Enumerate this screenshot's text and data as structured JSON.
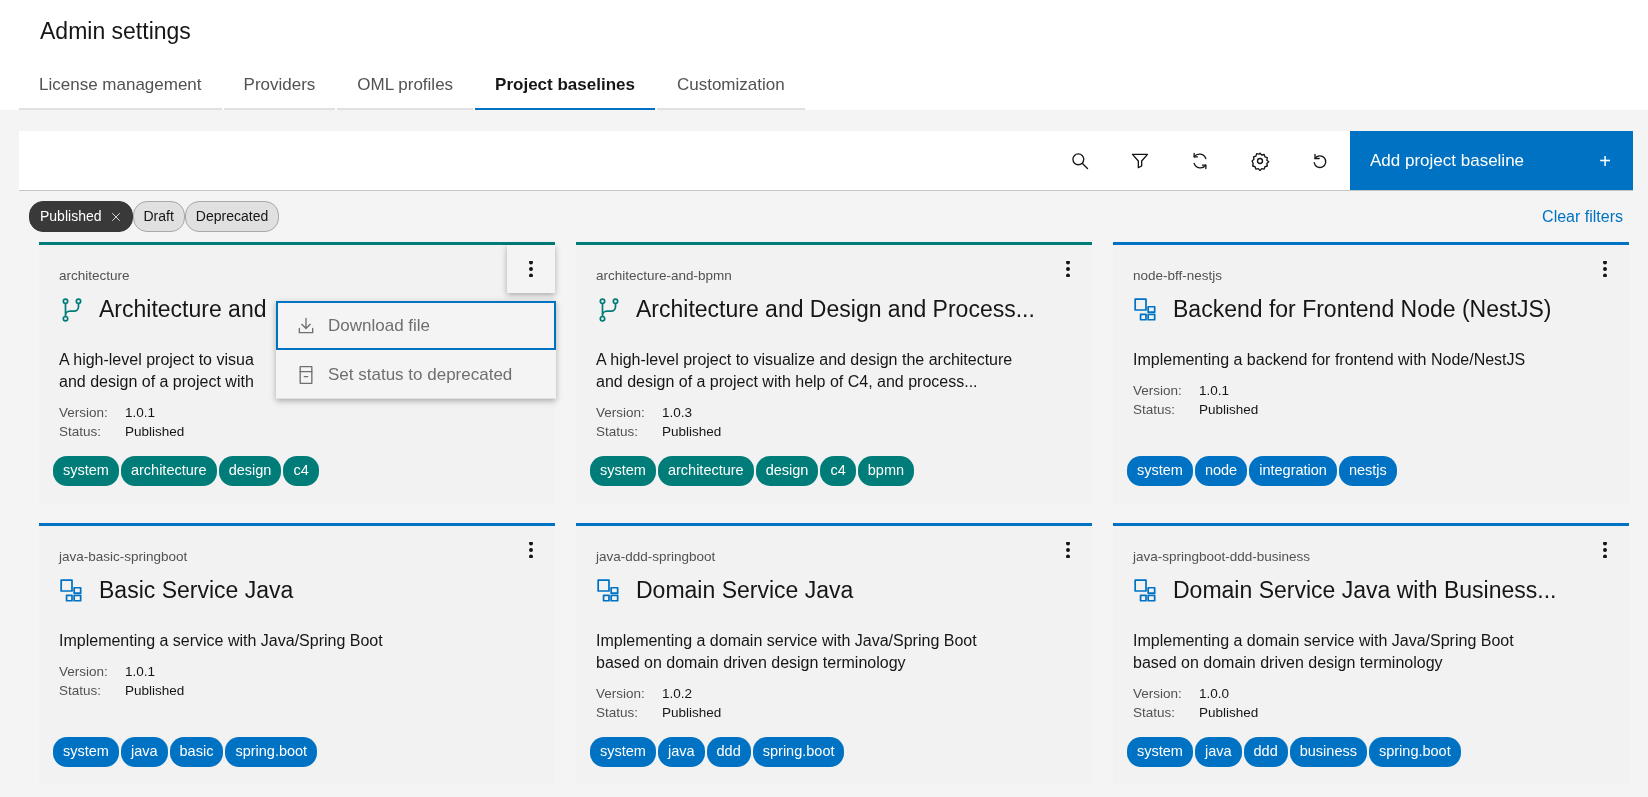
{
  "page": {
    "title": "Admin settings"
  },
  "tabs": [
    {
      "label": "License management",
      "selected": false
    },
    {
      "label": "Providers",
      "selected": false
    },
    {
      "label": "OML profiles",
      "selected": false
    },
    {
      "label": "Project baselines",
      "selected": true
    },
    {
      "label": "Customization",
      "selected": false
    }
  ],
  "toolbar": {
    "add_button": "Add project baseline",
    "add_icon": "+"
  },
  "filters": [
    {
      "label": "Published",
      "selected": true
    },
    {
      "label": "Draft",
      "selected": false
    },
    {
      "label": "Deprecated",
      "selected": false
    }
  ],
  "clear_filters": "Clear filters",
  "cards": [
    {
      "kind": "branch",
      "id_label": "architecture",
      "title": "Architecture and",
      "description_lines": [
        "A high-level project to visua",
        "and design of a project with"
      ],
      "version_label": "Version:",
      "version": "1.0.1",
      "status_label": "Status:",
      "status": "Published",
      "tags": [
        "system",
        "architecture",
        "design",
        "c4"
      ],
      "menu_open": true,
      "menu": [
        {
          "label": "Download file",
          "kind": "download",
          "selected": true
        },
        {
          "label": "Set status to deprecated",
          "kind": "archive",
          "selected": false
        }
      ]
    },
    {
      "kind": "branch",
      "id_label": "architecture-and-bpmn",
      "title": "Architecture and Design and Process...",
      "description_lines": [
        "A high-level project to visualize and design the architecture",
        "and design of a project with help of C4, and process..."
      ],
      "version_label": "Version:",
      "version": "1.0.3",
      "status_label": "Status:",
      "status": "Published",
      "tags": [
        "system",
        "architecture",
        "design",
        "c4",
        "bpmn"
      ],
      "menu_open": false
    },
    {
      "kind": "component",
      "id_label": "node-bff-nestjs",
      "title": "Backend for Frontend Node (NestJS)",
      "description_lines": [
        "Implementing a backend for frontend with Node/NestJS"
      ],
      "version_label": "Version:",
      "version": "1.0.1",
      "status_label": "Status:",
      "status": "Published",
      "tags": [
        "system",
        "node",
        "integration",
        "nestjs"
      ],
      "menu_open": false
    },
    {
      "kind": "component",
      "id_label": "java-basic-springboot",
      "title": "Basic Service Java",
      "description_lines": [
        "Implementing a service with Java/Spring Boot"
      ],
      "version_label": "Version:",
      "version": "1.0.1",
      "status_label": "Status:",
      "status": "Published",
      "tags": [
        "system",
        "java",
        "basic",
        "spring.boot"
      ],
      "menu_open": false
    },
    {
      "kind": "component",
      "id_label": "java-ddd-springboot",
      "title": "Domain Service Java",
      "description_lines": [
        "Implementing a domain service with Java/Spring Boot",
        "based on domain driven design terminology"
      ],
      "version_label": "Version:",
      "version": "1.0.2",
      "status_label": "Status:",
      "status": "Published",
      "tags": [
        "system",
        "java",
        "ddd",
        "spring.boot"
      ],
      "menu_open": false
    },
    {
      "kind": "component",
      "id_label": "java-springboot-ddd-business",
      "title": "Domain Service Java with Business...",
      "description_lines": [
        "Implementing a domain service with Java/Spring Boot",
        "based on domain driven design terminology"
      ],
      "version_label": "Version:",
      "version": "1.0.0",
      "status_label": "Status:",
      "status": "Published",
      "tags": [
        "system",
        "java",
        "ddd",
        "business",
        "spring.boot"
      ],
      "menu_open": false
    }
  ]
}
